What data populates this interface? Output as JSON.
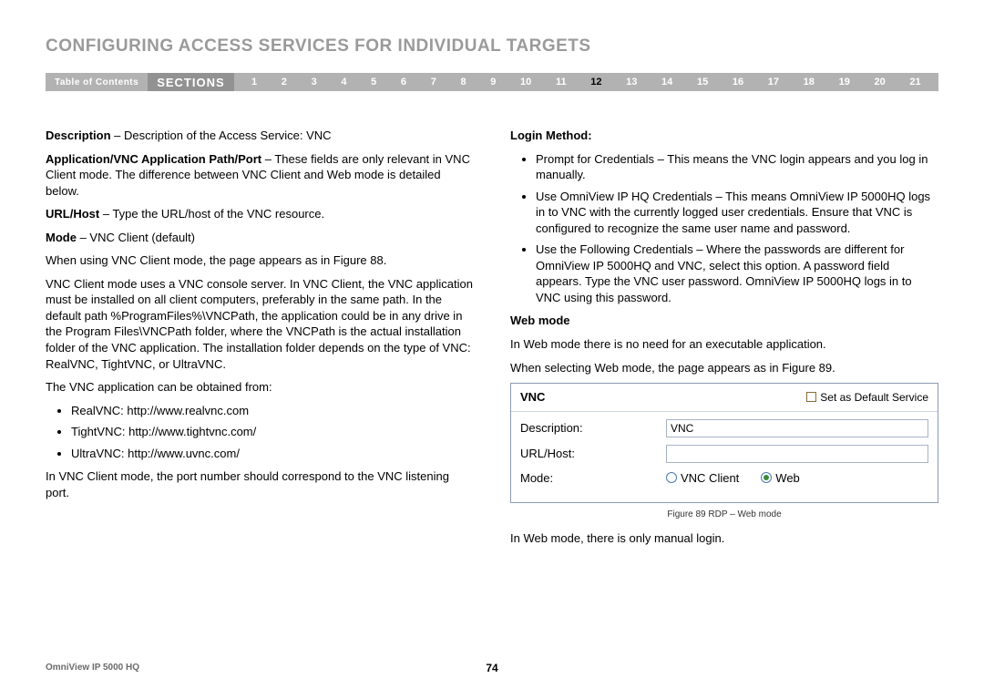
{
  "title": "CONFIGURING ACCESS SERVICES FOR INDIVIDUAL TARGETS",
  "nav": {
    "toc": "Table of Contents",
    "sections_label": "SECTIONS",
    "numbers": [
      "1",
      "2",
      "3",
      "4",
      "5",
      "6",
      "7",
      "8",
      "9",
      "10",
      "11",
      "12",
      "13",
      "14",
      "15",
      "16",
      "17",
      "18",
      "19",
      "20",
      "21"
    ],
    "active": "12"
  },
  "left": {
    "p1_bold": "Description",
    "p1_rest": " – Description of the Access Service: VNC",
    "p2_bold": "Application/VNC Application Path/Port",
    "p2_rest": " – These fields are only relevant in VNC Client mode. The difference between VNC Client and Web mode is detailed below.",
    "p3_bold": "URL/Host",
    "p3_rest": " – Type the URL/host of the VNC resource.",
    "p4_bold": "Mode",
    "p4_rest": " – VNC Client (default)",
    "p5": "When using VNC Client mode, the page appears as in Figure 88.",
    "p6": "VNC Client mode uses a VNC console server. In VNC Client, the VNC application must be installed on all client computers, preferably in the same path. In the default path %ProgramFiles%\\VNCPath, the application could be in any drive in the Program Files\\VNCPath folder, where the VNCPath is the actual installation folder of the VNC application. The installation folder depends on the type of VNC: RealVNC, TightVNC, or UltraVNC.",
    "p7": "The VNC application can be obtained from:",
    "li1": "RealVNC: http://www.realvnc.com",
    "li2": "TightVNC: http://www.tightvnc.com/",
    "li3": "UltraVNC: http://www.uvnc.com/",
    "p8": "In VNC Client mode, the port number should correspond to the VNC listening port."
  },
  "right": {
    "h1": "Login Method:",
    "b1": "Prompt for Credentials – This means the VNC login appears and you log in manually.",
    "b2": "Use OmniView IP HQ Credentials – This means OmniView IP 5000HQ logs in to VNC with the currently logged user credentials. Ensure that VNC is configured to recognize the same user name and password.",
    "b3": "Use the Following Credentials – Where the passwords are different for OmniView IP 5000HQ and VNC, select this option. A password field appears. Type the VNC user password. OmniView IP 5000HQ logs in to VNC using this password.",
    "h2": "Web mode",
    "p1": "In Web mode there is no need for an executable application.",
    "p2": "When selecting Web mode, the page appears as in Figure 89.",
    "fig": {
      "head_left": "VNC",
      "head_right": "Set as Default Service",
      "row1_lbl": "Description:",
      "row1_val": "VNC",
      "row2_lbl": "URL/Host:",
      "row2_val": "",
      "row3_lbl": "Mode:",
      "radio1": "VNC Client",
      "radio2": "Web"
    },
    "caption": "Figure 89 RDP – Web mode",
    "p3": "In Web mode, there is only manual login."
  },
  "footer": {
    "left": "OmniView IP 5000 HQ",
    "page": "74"
  }
}
